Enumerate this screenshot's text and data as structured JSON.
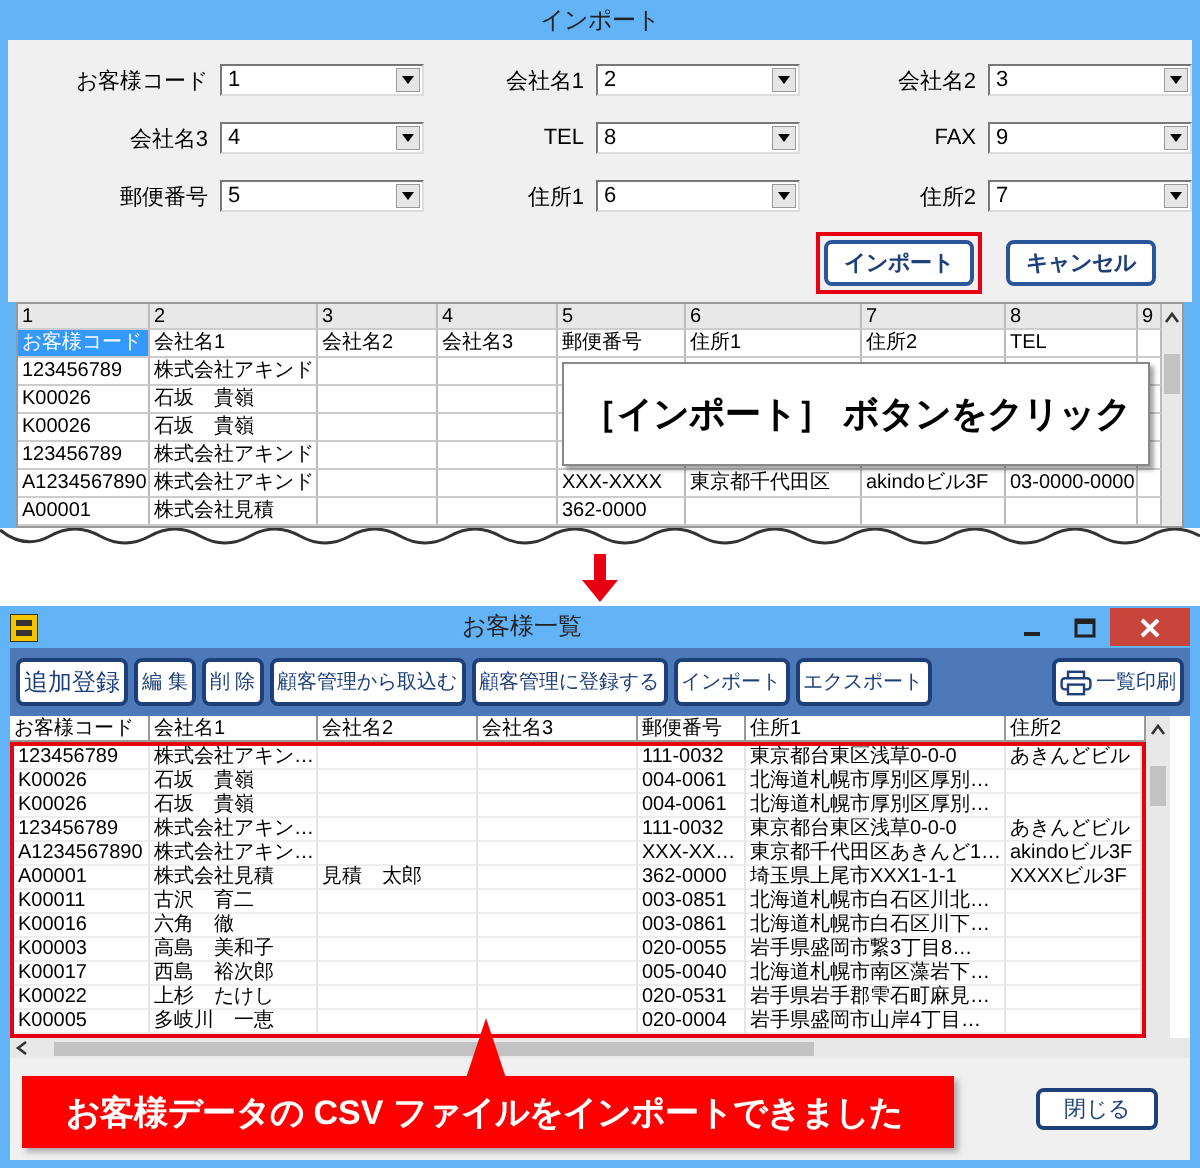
{
  "import_dialog": {
    "title": "インポート",
    "fields": [
      {
        "label": "お客様コード",
        "value": "1"
      },
      {
        "label": "会社名1",
        "value": "2"
      },
      {
        "label": "会社名2",
        "value": "3"
      },
      {
        "label": "会社名3",
        "value": "4"
      },
      {
        "label": "TEL",
        "value": "8"
      },
      {
        "label": "FAX",
        "value": "9"
      },
      {
        "label": "郵便番号",
        "value": "5"
      },
      {
        "label": "住所1",
        "value": "6"
      },
      {
        "label": "住所2",
        "value": "7"
      }
    ],
    "buttons": [
      {
        "label": "インポート",
        "highlighted": true
      },
      {
        "label": "キャンセル",
        "highlighted": false
      }
    ],
    "grid": {
      "column_numbers": [
        "1",
        "2",
        "3",
        "4",
        "5",
        "6",
        "7",
        "8",
        "9"
      ],
      "rows": [
        {
          "first_cell_selected": true,
          "cells": [
            "お客様コード",
            "会社名1",
            "会社名2",
            "会社名3",
            "郵便番号",
            "住所1",
            "住所2",
            "TEL"
          ]
        },
        {
          "first_cell_selected": false,
          "cells": [
            "123456789",
            "株式会社アキンド",
            "",
            ""
          ]
        },
        {
          "first_cell_selected": false,
          "cells": [
            "K00026",
            "石坂　貴嶺",
            "",
            ""
          ]
        },
        {
          "first_cell_selected": false,
          "cells": [
            "K00026",
            "石坂　貴嶺",
            "",
            ""
          ]
        },
        {
          "first_cell_selected": false,
          "cells": [
            "123456789",
            "株式会社アキンド",
            "",
            ""
          ]
        },
        {
          "first_cell_selected": false,
          "cells": [
            "A1234567890",
            "株式会社アキンド",
            "",
            "",
            "XXX-XXXX",
            "東京都千代田区",
            "akindoビル3F",
            "03-0000-0000"
          ]
        },
        {
          "first_cell_selected": false,
          "cells": [
            "A00001",
            "株式会社見積",
            "",
            "",
            "362-0000"
          ]
        }
      ]
    },
    "callout": "［インポート］ ボタンをクリック"
  },
  "customer_list_window": {
    "title": "お客様一覧",
    "toolbar": [
      {
        "kind": "text",
        "label": "追加登録"
      },
      {
        "kind": "text",
        "label": "編 集"
      },
      {
        "kind": "text",
        "label": "削 除"
      },
      {
        "kind": "text",
        "label": "顧客管理から取込む"
      },
      {
        "kind": "text",
        "label": "顧客管理に登録する"
      },
      {
        "kind": "text",
        "label": "インポート"
      },
      {
        "kind": "text",
        "label": "エクスポート"
      },
      {
        "kind": "print",
        "label": "一覧印刷"
      }
    ],
    "columns": [
      "お客様コード",
      "会社名1",
      "会社名2",
      "会社名3",
      "郵便番号",
      "住所1",
      "住所2"
    ],
    "rows": [
      [
        "123456789",
        "株式会社アキン…",
        "",
        "",
        "111-0032",
        "東京都台東区浅草0-0-0",
        "あきんどビル"
      ],
      [
        "K00026",
        "石坂　貴嶺",
        "",
        "",
        "004-0061",
        "北海道札幌市厚別区厚別…",
        ""
      ],
      [
        "K00026",
        "石坂　貴嶺",
        "",
        "",
        "004-0061",
        "北海道札幌市厚別区厚別…",
        ""
      ],
      [
        "123456789",
        "株式会社アキン…",
        "",
        "",
        "111-0032",
        "東京都台東区浅草0-0-0",
        "あきんどビル"
      ],
      [
        "A1234567890",
        "株式会社アキン…",
        "",
        "",
        "XXX-XX…",
        "東京都千代田区あきんど1…",
        "akindoビル3F"
      ],
      [
        "A00001",
        "株式会社見積",
        "見積　太郎",
        "",
        "362-0000",
        "埼玉県上尾市XXX1-1-1",
        "XXXXビル3F"
      ],
      [
        "K00011",
        "古沢　育二",
        "",
        "",
        "003-0851",
        "北海道札幌市白石区川北…",
        ""
      ],
      [
        "K00016",
        "六角　徹",
        "",
        "",
        "003-0861",
        "北海道札幌市白石区川下…",
        ""
      ],
      [
        "K00003",
        "高島　美和子",
        "",
        "",
        "020-0055",
        "岩手県盛岡市繋3丁目8…",
        ""
      ],
      [
        "K00017",
        "西島　裕次郎",
        "",
        "",
        "005-0040",
        "北海道札幌市南区藻岩下…",
        ""
      ],
      [
        "K00022",
        "上杉　たけし",
        "",
        "",
        "020-0531",
        "岩手県岩手郡雫石町麻見…",
        ""
      ],
      [
        "K00005",
        "多岐川　一恵",
        "",
        "",
        "020-0004",
        "岩手県盛岡市山岸4丁目…",
        ""
      ]
    ],
    "callout": "お客様データの CSV ファイルをインポートできました",
    "close_button": "閉じる"
  }
}
